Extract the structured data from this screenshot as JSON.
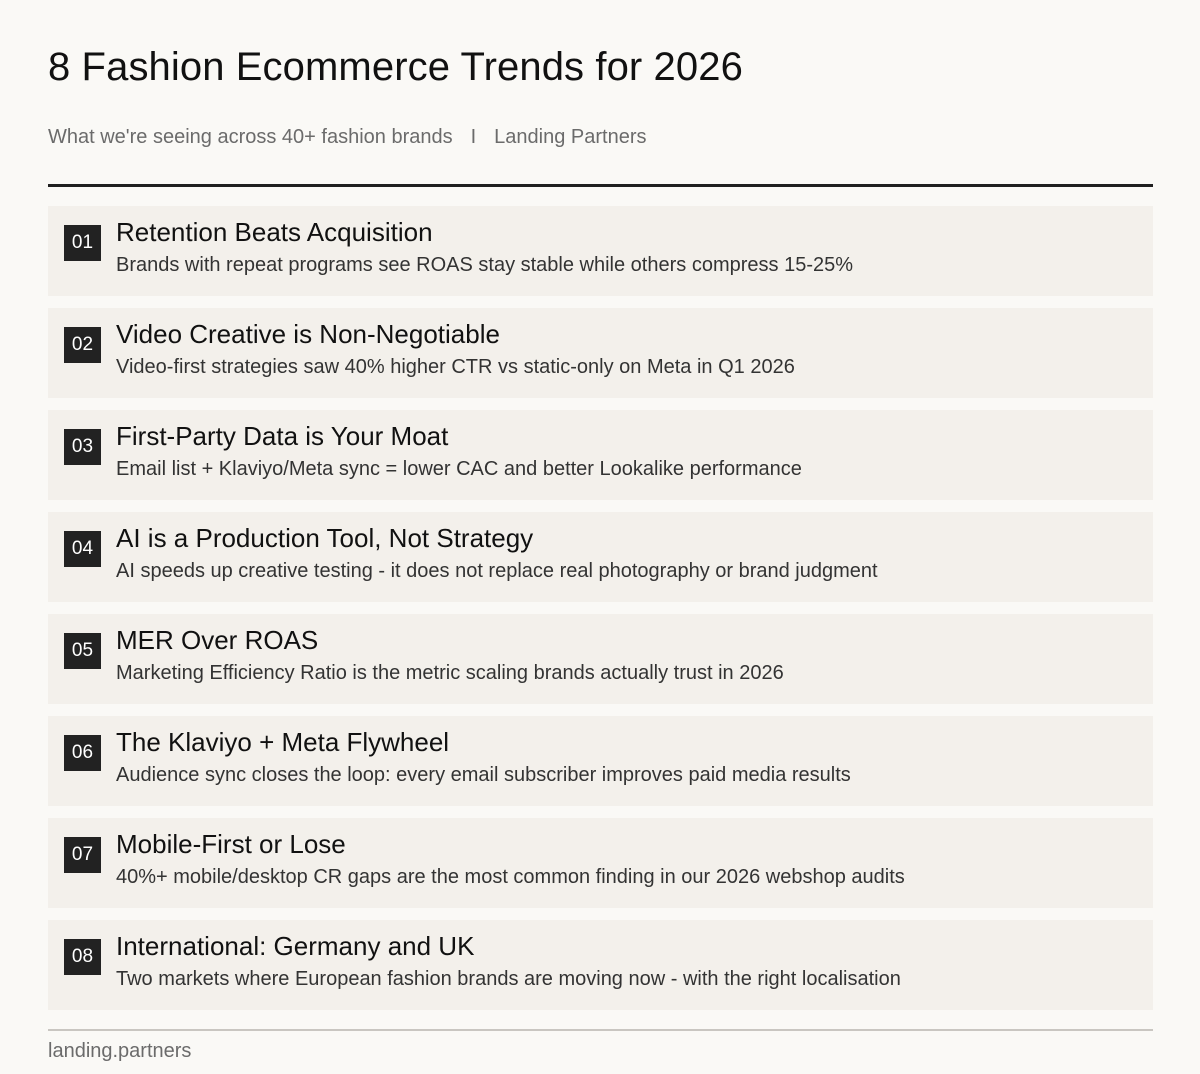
{
  "header": {
    "title": "8 Fashion Ecommerce Trends for 2026",
    "subtitle_left": "What we're seeing across 40+ fashion brands",
    "subtitle_sep": "I",
    "subtitle_right": "Landing Partners"
  },
  "trends": [
    {
      "num": "01",
      "title": "Retention Beats Acquisition",
      "desc": "Brands with repeat programs see ROAS stay stable while others compress 15-25%"
    },
    {
      "num": "02",
      "title": "Video Creative is Non-Negotiable",
      "desc": "Video-first strategies saw 40% higher CTR vs static-only on Meta in Q1 2026"
    },
    {
      "num": "03",
      "title": "First-Party Data is Your Moat",
      "desc": "Email list + Klaviyo/Meta sync = lower CAC and better Lookalike performance"
    },
    {
      "num": "04",
      "title": "AI is a Production Tool, Not Strategy",
      "desc": "AI speeds up creative testing - it does not replace real photography or brand judgment"
    },
    {
      "num": "05",
      "title": "MER Over ROAS",
      "desc": "Marketing Efficiency Ratio is the metric scaling brands actually trust in 2026"
    },
    {
      "num": "06",
      "title": "The Klaviyo + Meta Flywheel",
      "desc": "Audience sync closes the loop: every email subscriber improves paid media results"
    },
    {
      "num": "07",
      "title": "Mobile-First or Lose",
      "desc": "40%+ mobile/desktop CR gaps are the most common finding in our 2026 webshop audits"
    },
    {
      "num": "08",
      "title": "International: Germany and UK",
      "desc": "Two markets where European fashion brands are moving now - with the right localisation"
    }
  ],
  "footer": {
    "domain": "landing.partners"
  },
  "colors": {
    "background": "#faf9f6",
    "card": "#f3f0eb",
    "badge": "#222222",
    "muted_text": "#6b6b6b"
  }
}
